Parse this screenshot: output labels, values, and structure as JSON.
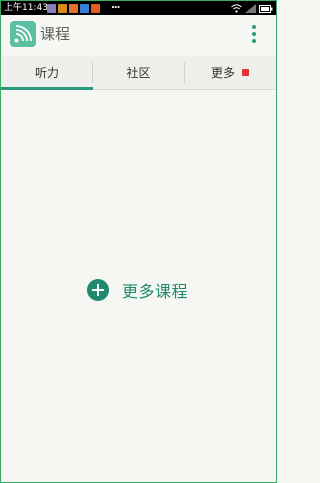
{
  "status_bar": {
    "time": "上午11:43",
    "more": "...",
    "notification_colors": [
      "#8a7fb8",
      "#d88b1c",
      "#e0732b",
      "#3b7ed8",
      "#e05d24"
    ]
  },
  "app_bar": {
    "title": "课程",
    "logo_color": "#5bbfa1",
    "accent": "#2a9a7e"
  },
  "tabs": [
    {
      "label": "听力",
      "selected": true
    },
    {
      "label": "社区",
      "selected": false
    },
    {
      "label": "更多",
      "selected": false,
      "badge": true
    }
  ],
  "main": {
    "add_courses_label": "更多课程"
  },
  "colors": {
    "primary": "#1f8a70",
    "badge": "#e03535",
    "background": "#f6f6f2"
  }
}
